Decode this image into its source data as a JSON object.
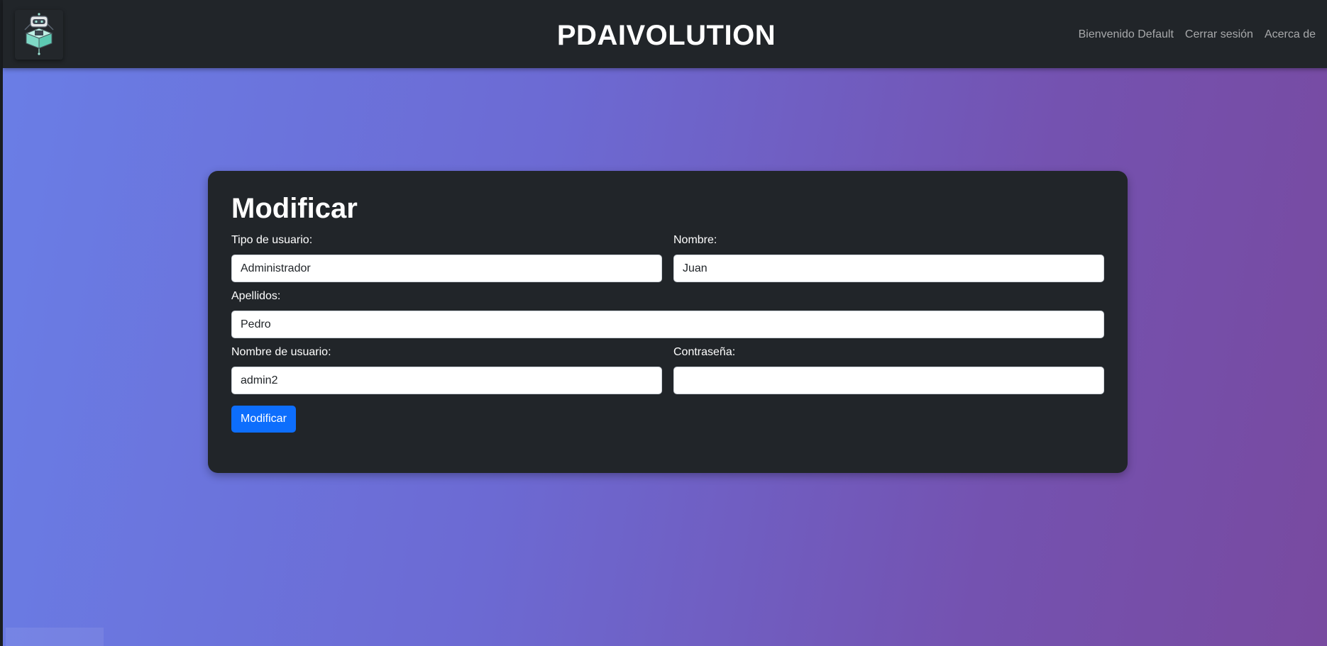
{
  "navbar": {
    "brand": "PDAIVOLUTION",
    "links": [
      {
        "label": "Bienvenido Default"
      },
      {
        "label": "Cerrar sesión"
      },
      {
        "label": "Acerca de"
      }
    ],
    "logo_icon": "robot-box-icon"
  },
  "form": {
    "title": "Modificar",
    "fields": {
      "tipo_usuario": {
        "label": "Tipo de usuario:",
        "value": "Administrador"
      },
      "nombre": {
        "label": "Nombre:",
        "value": "Juan"
      },
      "apellidos": {
        "label": "Apellidos:",
        "value": "Pedro"
      },
      "nombre_usuario": {
        "label": "Nombre de usuario:",
        "value": "admin2"
      },
      "contrasena": {
        "label": "Contraseña:",
        "value": ""
      }
    },
    "submit_label": "Modificar"
  },
  "colors": {
    "navbar_bg": "#212529",
    "card_bg": "#212529",
    "primary_button": "#0d6efd",
    "gradient_start": "#6a7ee6",
    "gradient_end": "#784aa0"
  }
}
